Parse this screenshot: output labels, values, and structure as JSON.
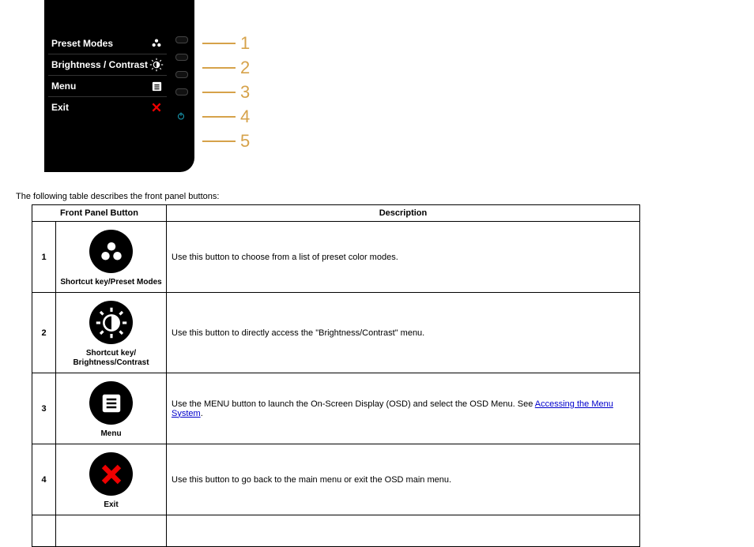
{
  "diagram": {
    "osd_items": [
      {
        "label": "Preset Modes",
        "icon": "preset-modes-icon"
      },
      {
        "label": "Brightness / Contrast",
        "icon": "brightness-contrast-icon"
      },
      {
        "label": "Menu",
        "icon": "menu-icon"
      },
      {
        "label": "Exit",
        "icon": "exit-icon"
      }
    ],
    "callouts": [
      "1",
      "2",
      "3",
      "4",
      "5"
    ]
  },
  "intro": "The following table describes the front panel buttons:",
  "table": {
    "headers": {
      "button": "Front Panel Button",
      "description": "Description"
    },
    "rows": [
      {
        "num": "1",
        "label": "Shortcut key/Preset Modes",
        "desc": "Use this button to choose from a list of preset color modes."
      },
      {
        "num": "2",
        "label": "Shortcut key/ Brightness/Contrast",
        "desc": "Use this button to directly access the \"Brightness/Contrast\" menu."
      },
      {
        "num": "3",
        "label": "Menu",
        "desc_pre": "Use the MENU button to launch the On-Screen Display (OSD) and select the OSD Menu. See ",
        "desc_link": "Accessing the Menu System",
        "desc_post": "."
      },
      {
        "num": "4",
        "label": "Exit",
        "desc": "Use this button to go back to the main menu or exit the OSD main menu."
      }
    ]
  }
}
